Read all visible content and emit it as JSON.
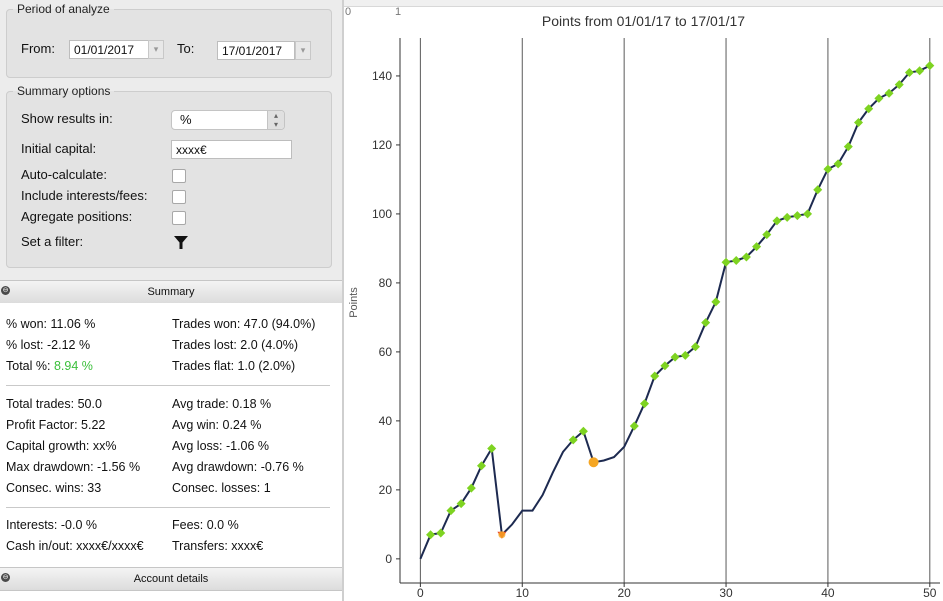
{
  "period": {
    "legend": "Period of analyze",
    "from_label": "From:",
    "from_value": "01/01/2017",
    "to_label": "To:",
    "to_value": "17/01/2017"
  },
  "summary_options": {
    "legend": "Summary options",
    "show_results_label": "Show results in:",
    "show_results_value": "%",
    "initial_capital_label": "Initial capital:",
    "initial_capital_value": "xxxx€",
    "auto_calculate_label": "Auto-calculate:",
    "include_interests_label": "Include interests/fees:",
    "aggregate_label": "Agregate positions:",
    "filter_label": "Set a filter:"
  },
  "summary": {
    "title": "Summary",
    "left": [
      "% won: 11.06 %",
      "% lost: -2.12 %"
    ],
    "total_prefix": "Total %: ",
    "total_value": "8.94 %",
    "right": [
      "Trades won: 47.0 (94.0%)",
      "Trades lost: 2.0 (4.0%)",
      "Trades flat: 1.0 (2.0%)"
    ],
    "group2_left": [
      "Total trades: 50.0",
      "Profit Factor: 5.22",
      "Capital growth: xx%",
      "Max drawdown: -1.56 %",
      "Consec. wins: 33"
    ],
    "group2_right": [
      "Avg trade: 0.18 %",
      "Avg win: 0.24 %",
      "Avg loss: -1.06 %",
      "Avg drawdown: -0.76 %",
      "Consec. losses: 1"
    ],
    "group3_left": [
      "Interests: -0.0 %",
      "Cash in/out: xxxx€/xxxx€"
    ],
    "group3_right": [
      "Fees: 0.0 %",
      "Transfers: xxxx€"
    ]
  },
  "account_details": {
    "title": "Account details"
  },
  "top_strip": {
    "left_label": "0",
    "right_label": "1"
  },
  "colors": {
    "total_pct": "#3bbf3b",
    "line": "#1d2a50",
    "marker_win": "#7ed321",
    "marker_loss": "#e8452c",
    "marker_flat": "#f5a623"
  },
  "chart_data": {
    "type": "line",
    "title": "Points from 01/01/17 to 17/01/17",
    "ylabel": "Points",
    "xlabel": "",
    "xlim": [
      -2,
      51
    ],
    "ylim": [
      -7,
      151
    ],
    "x_ticks": [
      0,
      10,
      20,
      30,
      40,
      50
    ],
    "y_ticks": [
      0,
      20,
      40,
      60,
      80,
      100,
      120,
      140
    ],
    "grid": {
      "vertical": true,
      "horizontal": false
    },
    "series": [
      {
        "points": [
          [
            0,
            0
          ],
          [
            1,
            7
          ],
          [
            2,
            7.5
          ],
          [
            3,
            14
          ],
          [
            4,
            16
          ],
          [
            5,
            20.5
          ],
          [
            6,
            27
          ],
          [
            7,
            32
          ],
          [
            8,
            7
          ],
          [
            9,
            10
          ],
          [
            10,
            14
          ],
          [
            11,
            14
          ],
          [
            12,
            18.5
          ],
          [
            13,
            25
          ],
          [
            14,
            31
          ],
          [
            15,
            34.5
          ],
          [
            16,
            37
          ],
          [
            17,
            28
          ],
          [
            18,
            28.5
          ],
          [
            19,
            29.5
          ],
          [
            20,
            32.5
          ],
          [
            21,
            38.5
          ],
          [
            22,
            45
          ],
          [
            23,
            53
          ],
          [
            24,
            56
          ],
          [
            25,
            58.5
          ],
          [
            26,
            59
          ],
          [
            27,
            61.5
          ],
          [
            28,
            68.5
          ],
          [
            29,
            74.5
          ],
          [
            30,
            86
          ],
          [
            31,
            86.5
          ],
          [
            32,
            87.5
          ],
          [
            33,
            90.5
          ],
          [
            34,
            94
          ],
          [
            35,
            98
          ],
          [
            36,
            99
          ],
          [
            37,
            99.5
          ],
          [
            38,
            100
          ],
          [
            39,
            107
          ],
          [
            40,
            113
          ],
          [
            41,
            114.5
          ],
          [
            42,
            119.5
          ],
          [
            43,
            126.5
          ],
          [
            44,
            130.5
          ],
          [
            45,
            133.5
          ],
          [
            46,
            135
          ],
          [
            47,
            137.5
          ],
          [
            48,
            141
          ],
          [
            49,
            141.5
          ],
          [
            50,
            143
          ]
        ],
        "markers": [
          {
            "x": 1,
            "y": 7,
            "result": "win"
          },
          {
            "x": 2,
            "y": 7.5,
            "result": "win"
          },
          {
            "x": 3,
            "y": 14,
            "result": "win"
          },
          {
            "x": 4,
            "y": 16,
            "result": "win"
          },
          {
            "x": 5,
            "y": 20.5,
            "result": "win"
          },
          {
            "x": 6,
            "y": 27,
            "result": "win"
          },
          {
            "x": 7,
            "y": 32,
            "result": "win"
          },
          {
            "x": 8,
            "y": 7,
            "result": "loss"
          },
          {
            "x": 15,
            "y": 34.5,
            "result": "win"
          },
          {
            "x": 16,
            "y": 37,
            "result": "win"
          },
          {
            "x": 17,
            "y": 28,
            "result": "flat"
          },
          {
            "x": 21,
            "y": 38.5,
            "result": "win"
          },
          {
            "x": 22,
            "y": 45,
            "result": "win"
          },
          {
            "x": 23,
            "y": 53,
            "result": "win"
          },
          {
            "x": 24,
            "y": 56,
            "result": "win"
          },
          {
            "x": 25,
            "y": 58.5,
            "result": "win"
          },
          {
            "x": 26,
            "y": 59,
            "result": "win"
          },
          {
            "x": 27,
            "y": 61.5,
            "result": "win"
          },
          {
            "x": 28,
            "y": 68.5,
            "result": "win"
          },
          {
            "x": 29,
            "y": 74.5,
            "result": "win"
          },
          {
            "x": 30,
            "y": 86,
            "result": "win"
          },
          {
            "x": 31,
            "y": 86.5,
            "result": "win"
          },
          {
            "x": 32,
            "y": 87.5,
            "result": "win"
          },
          {
            "x": 33,
            "y": 90.5,
            "result": "win"
          },
          {
            "x": 34,
            "y": 94,
            "result": "win"
          },
          {
            "x": 35,
            "y": 98,
            "result": "win"
          },
          {
            "x": 36,
            "y": 99,
            "result": "win"
          },
          {
            "x": 37,
            "y": 99.5,
            "result": "win"
          },
          {
            "x": 38,
            "y": 100,
            "result": "win"
          },
          {
            "x": 39,
            "y": 107,
            "result": "win"
          },
          {
            "x": 40,
            "y": 113,
            "result": "win"
          },
          {
            "x": 41,
            "y": 114.5,
            "result": "win"
          },
          {
            "x": 42,
            "y": 119.5,
            "result": "win"
          },
          {
            "x": 43,
            "y": 126.5,
            "result": "win"
          },
          {
            "x": 44,
            "y": 130.5,
            "result": "win"
          },
          {
            "x": 45,
            "y": 133.5,
            "result": "win"
          },
          {
            "x": 46,
            "y": 135,
            "result": "win"
          },
          {
            "x": 47,
            "y": 137.5,
            "result": "win"
          },
          {
            "x": 48,
            "y": 141,
            "result": "win"
          },
          {
            "x": 49,
            "y": 141.5,
            "result": "win"
          },
          {
            "x": 50,
            "y": 143,
            "result": "win"
          }
        ]
      }
    ]
  }
}
